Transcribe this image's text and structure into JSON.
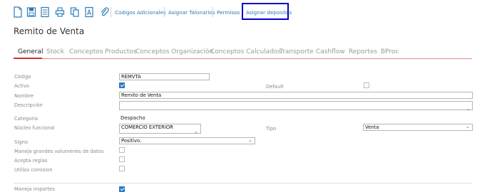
{
  "toolbar": {
    "icons": [
      "new-document-icon",
      "save-icon",
      "document-list-icon",
      "print-icon",
      "copy-icon",
      "text-icon",
      "attach-icon"
    ],
    "links": [
      "Codigos Adicionales",
      "Asignar Talonarios",
      "Permisos",
      "Asignar depositos"
    ],
    "link_color": "#2a7ab8",
    "highlight_color": "#0000cc"
  },
  "page": {
    "title": "Remito de Venta"
  },
  "tabs": [
    "General",
    "Stock",
    "Conceptos Productos",
    "Conceptos Organización",
    "Conceptos Calculados",
    "Transporte",
    "Cashflow",
    "Reportes",
    "BProc"
  ],
  "form": {
    "codigo": {
      "label": "Código",
      "value": "REMVTA"
    },
    "activo": {
      "label": "Activo",
      "checked": true
    },
    "default": {
      "label": "Default",
      "checked": false
    },
    "nombre": {
      "label": "Nombre",
      "value": "Remito de Venta"
    },
    "descripcion": {
      "label": "Descripción",
      "value": ""
    },
    "categoria": {
      "label": "Categoria",
      "value": "Despacho"
    },
    "nucleo": {
      "label": "Núcleo funcional",
      "value": "COMERCIO EXTERIOR"
    },
    "tipo": {
      "label": "Tipo",
      "value": "Venta"
    },
    "signo": {
      "label": "Signo",
      "value": "Positivo."
    },
    "maneja_grandes": {
      "label": "Maneja grandes volumenes de datos",
      "checked": false
    },
    "acepta_reglas": {
      "label": "Acepta reglas",
      "checked": false
    },
    "utiliza_comision": {
      "label": "Utiliza comision",
      "checked": false
    },
    "maneja_importes": {
      "label": "Maneja importes",
      "checked": true
    }
  },
  "colors": {
    "accent": "#c33333",
    "checkbox": "#2b7ac9"
  }
}
